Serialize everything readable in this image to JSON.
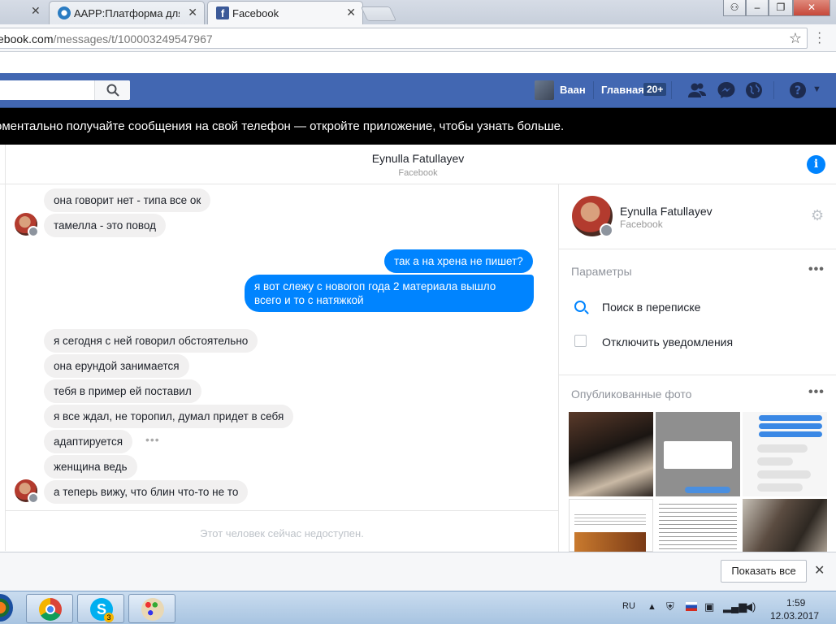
{
  "browser": {
    "tabs": [
      {
        "title": "AAPP:Платформа для м",
        "active": false
      },
      {
        "title": "Facebook",
        "active": true
      }
    ],
    "url_host": "ebook.com",
    "url_path": "/messages/t/100003249547967"
  },
  "fb_header": {
    "user_name": "Ваан",
    "home_label": "Главная",
    "home_badge": "20+"
  },
  "notice": {
    "text": "оментально получайте сообщения на свой телефон — откройте приложение, чтобы узнать больше."
  },
  "conversation": {
    "contact_name": "Eynulla Fatullayev",
    "contact_source": "Facebook",
    "messages": [
      {
        "dir": "in",
        "text": "она говорит нет - типа все ок"
      },
      {
        "dir": "in",
        "text": "тамелла - это повод"
      },
      {
        "dir": "out",
        "text": "так а на хрена не пишет?"
      },
      {
        "dir": "out",
        "text": "я вот слежу с новогоп года 2 материала вышло"
      },
      {
        "dir": "out",
        "text": "всего и то с натяжкой"
      },
      {
        "dir": "in",
        "text": "я сегодня с ней говорил обстоятельно"
      },
      {
        "dir": "in",
        "text": "она ерундой занимается"
      },
      {
        "dir": "in",
        "text": "тебя в пример ей поставил"
      },
      {
        "dir": "in",
        "text": "я все ждал, не торопил, думал придет в себя"
      },
      {
        "dir": "in",
        "text": "адаптируется"
      },
      {
        "dir": "in",
        "text": "женщина ведь"
      },
      {
        "dir": "in",
        "text": "а теперь вижу, что блин что-то не то"
      }
    ],
    "typing_dots": "•••",
    "unavailable_text": "Этот человек сейчас недоступен."
  },
  "right_panel": {
    "name": "Eynulla Fatullayev",
    "source": "Facebook",
    "params_title": "Параметры",
    "search_label": "Поиск в переписке",
    "mute_label": "Отключить уведомления",
    "photos_title": "Опубликованные фото",
    "more": "•••"
  },
  "download_bar": {
    "show_all": "Показать все"
  },
  "taskbar": {
    "lang": "RU",
    "time": "1:59",
    "date": "12.03.2017",
    "skype_badge": "3"
  },
  "colors": {
    "fb_blue": "#4267b2",
    "messenger_blue": "#0084ff",
    "bubble_gray": "#f1f0f0"
  }
}
